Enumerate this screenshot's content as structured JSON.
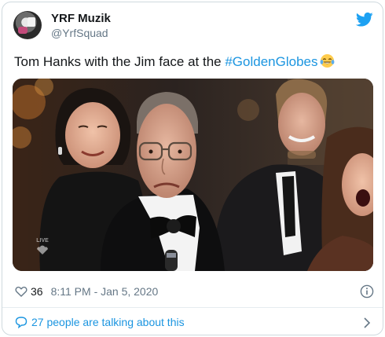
{
  "author": {
    "display_name": "YRF Muzik",
    "handle": "@YrfSquad"
  },
  "tweet": {
    "text_prefix": "Tom Hanks with the Jim face at the ",
    "hashtag": "#GoldenGlobes",
    "emoji": "face-with-tears-of-joy"
  },
  "media": {
    "live_badge": "LIVE"
  },
  "meta": {
    "like_count": "36",
    "timestamp": "8:11 PM - Jan 5, 2020"
  },
  "conversation": {
    "label": "27 people are talking about this"
  },
  "colors": {
    "accent": "#1b95e0",
    "secondary_text": "#657786",
    "border": "#cfd9de"
  },
  "icons": {
    "brand": "twitter-bird-icon",
    "like": "heart-icon",
    "info": "info-icon",
    "reply": "chat-bubble-icon",
    "more": "chevron-right-icon"
  }
}
